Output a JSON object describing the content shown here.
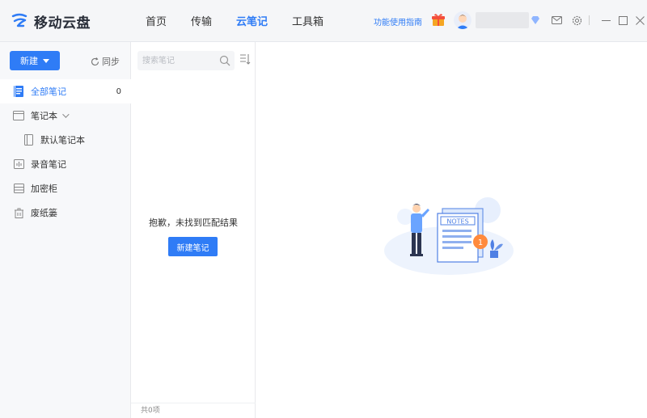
{
  "app": {
    "name": "移动云盘",
    "brand_color": "#2f7cf6"
  },
  "nav": {
    "items": [
      {
        "label": "首页",
        "active": false
      },
      {
        "label": "传输",
        "active": false
      },
      {
        "label": "云笔记",
        "active": true
      },
      {
        "label": "工具箱",
        "active": false
      }
    ]
  },
  "header": {
    "guide_label": "功能使用指南",
    "icons": [
      "gift-icon",
      "avatar",
      "vip-diamond-icon",
      "mail-icon",
      "settings-icon",
      "minimize-icon",
      "maximize-icon",
      "close-icon"
    ]
  },
  "sidebar": {
    "new_button": "新建",
    "sync_label": "同步",
    "items": [
      {
        "label": "全部笔记",
        "count": "0",
        "icon": "all-notes-icon",
        "active": true
      },
      {
        "label": "笔记本",
        "icon": "notebook-icon",
        "expandable": true
      },
      {
        "label": "默认笔记本",
        "icon": "default-notebook-icon",
        "sub": true
      },
      {
        "label": "录音笔记",
        "icon": "audio-note-icon"
      },
      {
        "label": "加密柜",
        "icon": "safe-icon"
      },
      {
        "label": "废纸篓",
        "icon": "trash-icon"
      }
    ]
  },
  "middle": {
    "search_placeholder": "搜索笔记",
    "empty_message": "抱歉，未找到匹配结果",
    "new_note_button": "新建笔记",
    "total_label": "共0项"
  },
  "content": {
    "illustration_label": "NOTES",
    "illustration_badge": "1"
  }
}
